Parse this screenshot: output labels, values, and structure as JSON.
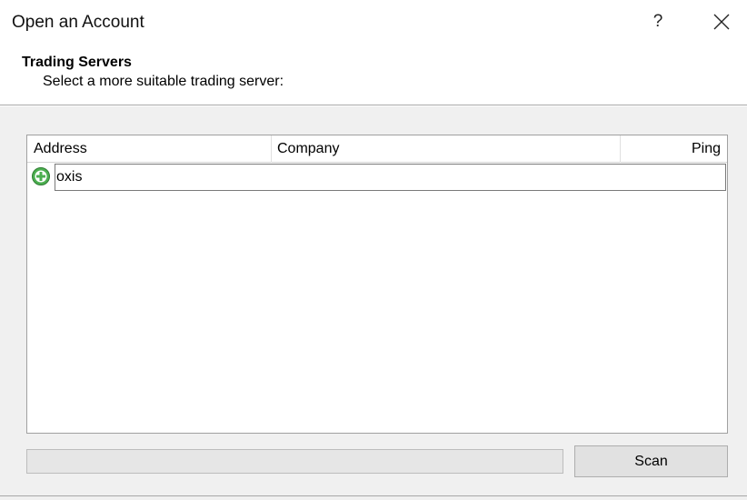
{
  "window": {
    "title": "Open an Account",
    "help_label": "?"
  },
  "header": {
    "title": "Trading Servers",
    "subtitle": "Select a more suitable trading server:"
  },
  "server_list": {
    "columns": {
      "address": "Address",
      "company": "Company",
      "ping": "Ping"
    },
    "new_row": {
      "value": "oxis",
      "icon": "add-circle-icon"
    }
  },
  "progress": {
    "value": 0
  },
  "actions": {
    "scan_label": "Scan"
  },
  "colors": {
    "add_icon": "#4caf50",
    "progress_fill": "#06b025",
    "body_bg": "#f0f0f0"
  }
}
